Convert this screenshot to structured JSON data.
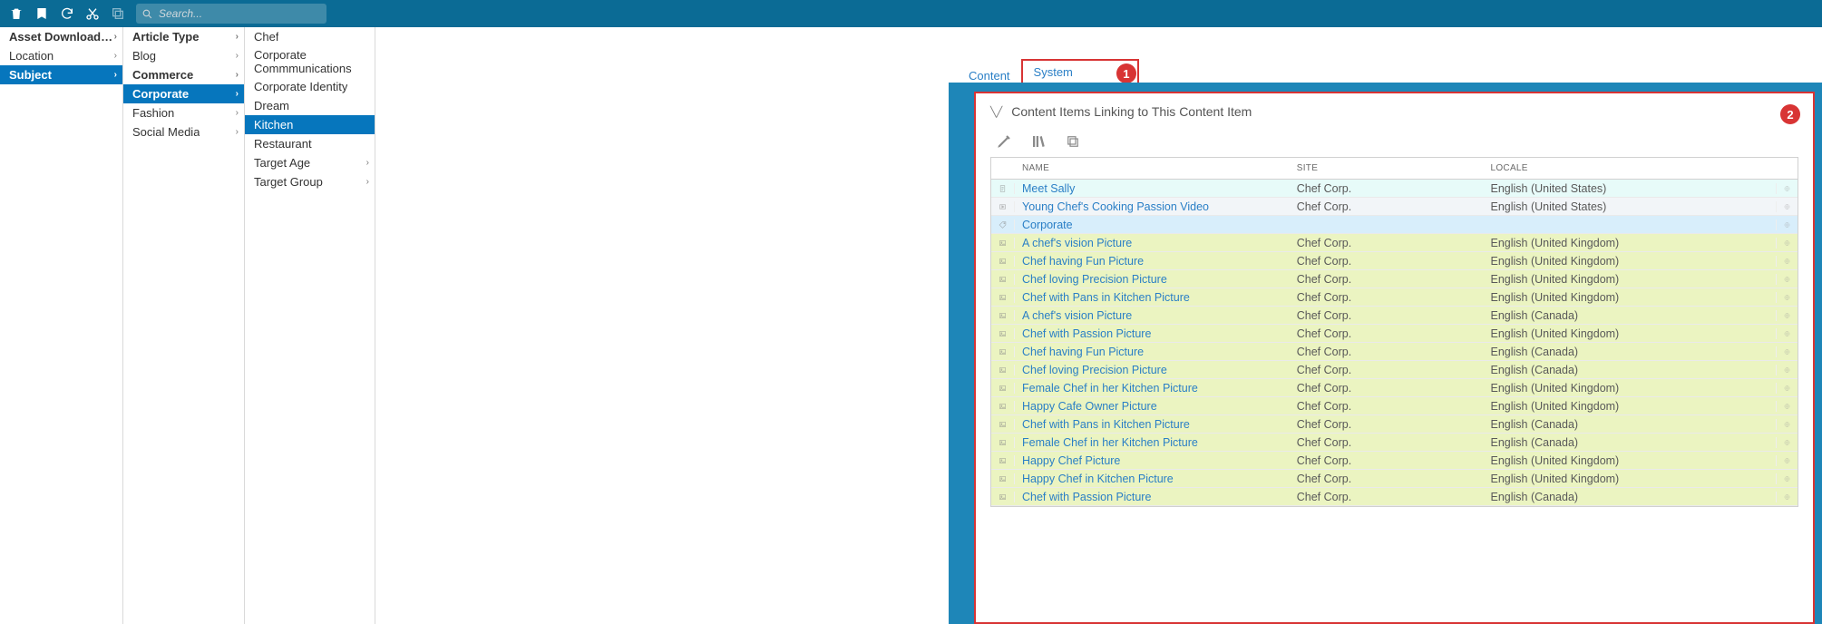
{
  "search": {
    "placeholder": "Search..."
  },
  "col1": [
    {
      "label": "Asset Download Portal",
      "strong": true,
      "chev": true
    },
    {
      "label": "Location",
      "chev": true
    },
    {
      "label": "Subject",
      "strong": true,
      "chev": true,
      "selected": true
    }
  ],
  "col2": [
    {
      "label": "Article Type",
      "strong": true,
      "chev": true
    },
    {
      "label": "Blog",
      "chev": true
    },
    {
      "label": "Commerce",
      "strong": true,
      "chev": true
    },
    {
      "label": "Corporate",
      "strong": true,
      "chev": true,
      "selected": true
    },
    {
      "label": "Fashion",
      "chev": true
    },
    {
      "label": "Social Media",
      "chev": true
    }
  ],
  "col3": [
    {
      "label": "Chef"
    },
    {
      "label": "Corporate Commmunications"
    },
    {
      "label": "Corporate Identity"
    },
    {
      "label": "Dream"
    },
    {
      "label": "Kitchen",
      "selected": true
    },
    {
      "label": "Restaurant"
    },
    {
      "label": "Target Age",
      "chev": true
    },
    {
      "label": "Target Group",
      "chev": true
    }
  ],
  "tabs": {
    "content": "Content",
    "system": "System",
    "badge1": "1"
  },
  "section": {
    "title": "Content Items Linking to This Content Item",
    "badge2": "2"
  },
  "headers": {
    "name": "NAME",
    "site": "SITE",
    "locale": "LOCALE"
  },
  "rows": [
    {
      "variant": "cyan",
      "icon": "page",
      "name": "Meet Sally",
      "site": "Chef Corp.",
      "locale": "English (United States)"
    },
    {
      "variant": "grey",
      "icon": "video",
      "name": "Young Chef's Cooking Passion Video",
      "site": "Chef Corp.",
      "locale": "English (United States)"
    },
    {
      "variant": "blue",
      "icon": "tag",
      "name": "Corporate",
      "site": "",
      "locale": ""
    },
    {
      "variant": "lime",
      "icon": "img",
      "name": "A chef's vision Picture",
      "site": "Chef Corp.",
      "locale": "English (United Kingdom)"
    },
    {
      "variant": "lime",
      "icon": "img",
      "name": "Chef having Fun Picture",
      "site": "Chef Corp.",
      "locale": "English (United Kingdom)"
    },
    {
      "variant": "lime",
      "icon": "img",
      "name": "Chef loving Precision Picture",
      "site": "Chef Corp.",
      "locale": "English (United Kingdom)"
    },
    {
      "variant": "lime",
      "icon": "img",
      "name": "Chef with Pans in Kitchen Picture",
      "site": "Chef Corp.",
      "locale": "English (United Kingdom)"
    },
    {
      "variant": "lime",
      "icon": "img",
      "name": "A chef's vision Picture",
      "site": "Chef Corp.",
      "locale": "English (Canada)"
    },
    {
      "variant": "lime",
      "icon": "img",
      "name": "Chef with Passion Picture",
      "site": "Chef Corp.",
      "locale": "English (United Kingdom)"
    },
    {
      "variant": "lime",
      "icon": "img",
      "name": "Chef having Fun Picture",
      "site": "Chef Corp.",
      "locale": "English (Canada)"
    },
    {
      "variant": "lime",
      "icon": "img",
      "name": "Chef loving Precision Picture",
      "site": "Chef Corp.",
      "locale": "English (Canada)"
    },
    {
      "variant": "lime",
      "icon": "img",
      "name": "Female Chef in her Kitchen Picture",
      "site": "Chef Corp.",
      "locale": "English (United Kingdom)"
    },
    {
      "variant": "lime",
      "icon": "img",
      "name": "Happy Cafe Owner Picture",
      "site": "Chef Corp.",
      "locale": "English (United Kingdom)"
    },
    {
      "variant": "lime",
      "icon": "img",
      "name": "Chef with Pans in Kitchen Picture",
      "site": "Chef Corp.",
      "locale": "English (Canada)"
    },
    {
      "variant": "lime",
      "icon": "img",
      "name": "Female Chef in her Kitchen Picture",
      "site": "Chef Corp.",
      "locale": "English (Canada)"
    },
    {
      "variant": "lime",
      "icon": "img",
      "name": "Happy Chef Picture",
      "site": "Chef Corp.",
      "locale": "English (United Kingdom)"
    },
    {
      "variant": "lime",
      "icon": "img",
      "name": "Happy Chef in Kitchen Picture",
      "site": "Chef Corp.",
      "locale": "English (United Kingdom)"
    },
    {
      "variant": "lime",
      "icon": "img",
      "name": "Chef with Passion Picture",
      "site": "Chef Corp.",
      "locale": "English (Canada)"
    }
  ]
}
